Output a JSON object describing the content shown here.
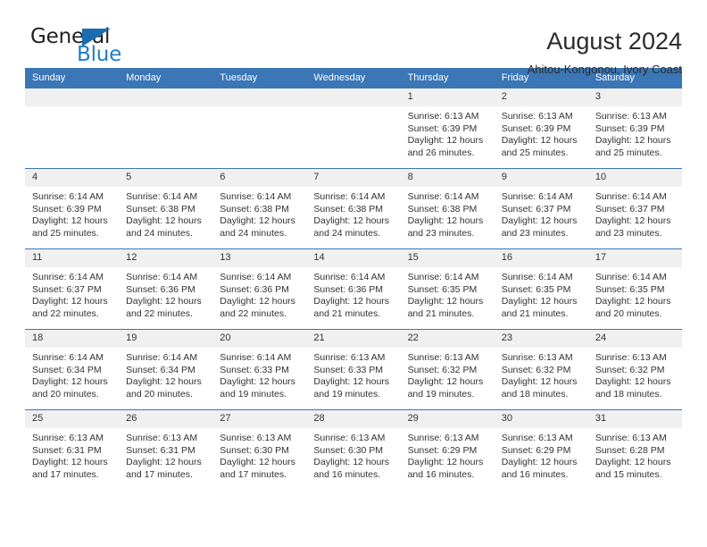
{
  "logo": {
    "primary_text": "General",
    "secondary_text": "Blue",
    "accent_color": "#1f7dc4"
  },
  "header": {
    "title": "August 2024",
    "subtitle": "Ahitou-Kongonou, Ivory Coast"
  },
  "theme": {
    "header_row_bg": "#3b76b6",
    "daynum_bg": "#f0f0f0",
    "text_color": "#333333"
  },
  "calendar": {
    "weekday_headers": [
      "Sunday",
      "Monday",
      "Tuesday",
      "Wednesday",
      "Thursday",
      "Friday",
      "Saturday"
    ],
    "weeks": [
      [
        {
          "day": "",
          "empty": true
        },
        {
          "day": "",
          "empty": true
        },
        {
          "day": "",
          "empty": true
        },
        {
          "day": "",
          "empty": true
        },
        {
          "day": "1",
          "sunrise": "Sunrise: 6:13 AM",
          "sunset": "Sunset: 6:39 PM",
          "daylight": "Daylight: 12 hours and 26 minutes."
        },
        {
          "day": "2",
          "sunrise": "Sunrise: 6:13 AM",
          "sunset": "Sunset: 6:39 PM",
          "daylight": "Daylight: 12 hours and 25 minutes."
        },
        {
          "day": "3",
          "sunrise": "Sunrise: 6:13 AM",
          "sunset": "Sunset: 6:39 PM",
          "daylight": "Daylight: 12 hours and 25 minutes."
        }
      ],
      [
        {
          "day": "4",
          "sunrise": "Sunrise: 6:14 AM",
          "sunset": "Sunset: 6:39 PM",
          "daylight": "Daylight: 12 hours and 25 minutes."
        },
        {
          "day": "5",
          "sunrise": "Sunrise: 6:14 AM",
          "sunset": "Sunset: 6:38 PM",
          "daylight": "Daylight: 12 hours and 24 minutes."
        },
        {
          "day": "6",
          "sunrise": "Sunrise: 6:14 AM",
          "sunset": "Sunset: 6:38 PM",
          "daylight": "Daylight: 12 hours and 24 minutes."
        },
        {
          "day": "7",
          "sunrise": "Sunrise: 6:14 AM",
          "sunset": "Sunset: 6:38 PM",
          "daylight": "Daylight: 12 hours and 24 minutes."
        },
        {
          "day": "8",
          "sunrise": "Sunrise: 6:14 AM",
          "sunset": "Sunset: 6:38 PM",
          "daylight": "Daylight: 12 hours and 23 minutes."
        },
        {
          "day": "9",
          "sunrise": "Sunrise: 6:14 AM",
          "sunset": "Sunset: 6:37 PM",
          "daylight": "Daylight: 12 hours and 23 minutes."
        },
        {
          "day": "10",
          "sunrise": "Sunrise: 6:14 AM",
          "sunset": "Sunset: 6:37 PM",
          "daylight": "Daylight: 12 hours and 23 minutes."
        }
      ],
      [
        {
          "day": "11",
          "sunrise": "Sunrise: 6:14 AM",
          "sunset": "Sunset: 6:37 PM",
          "daylight": "Daylight: 12 hours and 22 minutes."
        },
        {
          "day": "12",
          "sunrise": "Sunrise: 6:14 AM",
          "sunset": "Sunset: 6:36 PM",
          "daylight": "Daylight: 12 hours and 22 minutes."
        },
        {
          "day": "13",
          "sunrise": "Sunrise: 6:14 AM",
          "sunset": "Sunset: 6:36 PM",
          "daylight": "Daylight: 12 hours and 22 minutes."
        },
        {
          "day": "14",
          "sunrise": "Sunrise: 6:14 AM",
          "sunset": "Sunset: 6:36 PM",
          "daylight": "Daylight: 12 hours and 21 minutes."
        },
        {
          "day": "15",
          "sunrise": "Sunrise: 6:14 AM",
          "sunset": "Sunset: 6:35 PM",
          "daylight": "Daylight: 12 hours and 21 minutes."
        },
        {
          "day": "16",
          "sunrise": "Sunrise: 6:14 AM",
          "sunset": "Sunset: 6:35 PM",
          "daylight": "Daylight: 12 hours and 21 minutes."
        },
        {
          "day": "17",
          "sunrise": "Sunrise: 6:14 AM",
          "sunset": "Sunset: 6:35 PM",
          "daylight": "Daylight: 12 hours and 20 minutes."
        }
      ],
      [
        {
          "day": "18",
          "sunrise": "Sunrise: 6:14 AM",
          "sunset": "Sunset: 6:34 PM",
          "daylight": "Daylight: 12 hours and 20 minutes."
        },
        {
          "day": "19",
          "sunrise": "Sunrise: 6:14 AM",
          "sunset": "Sunset: 6:34 PM",
          "daylight": "Daylight: 12 hours and 20 minutes."
        },
        {
          "day": "20",
          "sunrise": "Sunrise: 6:14 AM",
          "sunset": "Sunset: 6:33 PM",
          "daylight": "Daylight: 12 hours and 19 minutes."
        },
        {
          "day": "21",
          "sunrise": "Sunrise: 6:13 AM",
          "sunset": "Sunset: 6:33 PM",
          "daylight": "Daylight: 12 hours and 19 minutes."
        },
        {
          "day": "22",
          "sunrise": "Sunrise: 6:13 AM",
          "sunset": "Sunset: 6:32 PM",
          "daylight": "Daylight: 12 hours and 19 minutes."
        },
        {
          "day": "23",
          "sunrise": "Sunrise: 6:13 AM",
          "sunset": "Sunset: 6:32 PM",
          "daylight": "Daylight: 12 hours and 18 minutes."
        },
        {
          "day": "24",
          "sunrise": "Sunrise: 6:13 AM",
          "sunset": "Sunset: 6:32 PM",
          "daylight": "Daylight: 12 hours and 18 minutes."
        }
      ],
      [
        {
          "day": "25",
          "sunrise": "Sunrise: 6:13 AM",
          "sunset": "Sunset: 6:31 PM",
          "daylight": "Daylight: 12 hours and 17 minutes."
        },
        {
          "day": "26",
          "sunrise": "Sunrise: 6:13 AM",
          "sunset": "Sunset: 6:31 PM",
          "daylight": "Daylight: 12 hours and 17 minutes."
        },
        {
          "day": "27",
          "sunrise": "Sunrise: 6:13 AM",
          "sunset": "Sunset: 6:30 PM",
          "daylight": "Daylight: 12 hours and 17 minutes."
        },
        {
          "day": "28",
          "sunrise": "Sunrise: 6:13 AM",
          "sunset": "Sunset: 6:30 PM",
          "daylight": "Daylight: 12 hours and 16 minutes."
        },
        {
          "day": "29",
          "sunrise": "Sunrise: 6:13 AM",
          "sunset": "Sunset: 6:29 PM",
          "daylight": "Daylight: 12 hours and 16 minutes."
        },
        {
          "day": "30",
          "sunrise": "Sunrise: 6:13 AM",
          "sunset": "Sunset: 6:29 PM",
          "daylight": "Daylight: 12 hours and 16 minutes."
        },
        {
          "day": "31",
          "sunrise": "Sunrise: 6:13 AM",
          "sunset": "Sunset: 6:28 PM",
          "daylight": "Daylight: 12 hours and 15 minutes."
        }
      ]
    ]
  }
}
